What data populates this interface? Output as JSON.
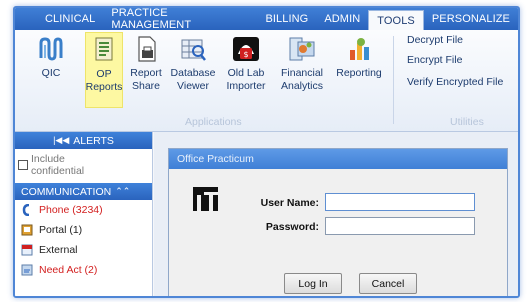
{
  "menu": {
    "tabs": [
      "CLINICAL",
      "PRACTICE MANAGEMENT",
      "BILLING",
      "ADMIN",
      "TOOLS",
      "PERSONALIZE"
    ],
    "active": "TOOLS"
  },
  "ribbon": {
    "buttons": {
      "qic": "QIC",
      "op_reports_1": "OP",
      "op_reports_2": "Reports",
      "report_share_1": "Report",
      "report_share_2": "Share",
      "database_viewer_1": "Database",
      "database_viewer_2": "Viewer",
      "old_lab_importer_1": "Old Lab",
      "old_lab_importer_2": "Importer",
      "financial_analytics_1": "Financial",
      "financial_analytics_2": "Analytics",
      "reporting": "Reporting"
    },
    "group_applications": "Applications",
    "utilities": {
      "decrypt": "Decrypt File",
      "encrypt": "Encrypt File",
      "verify": "Verify Encrypted File",
      "group_label": "Utilities"
    },
    "highlight_color": "#fdf8a2"
  },
  "left_pane": {
    "alerts_label": "ALERTS",
    "include_confidential_1": "Include",
    "include_confidential_2": "confidential",
    "communication_label": "COMMUNICATION",
    "items": [
      {
        "label": "Phone (3234)",
        "color": "#d31f1f"
      },
      {
        "label": "Portal (1)",
        "color": "#222222"
      },
      {
        "label": "External",
        "color": "#222222"
      },
      {
        "label": "Need Act (2)",
        "color": "#d31f1f"
      }
    ]
  },
  "login_dialog": {
    "title": "Office Practicum",
    "username_label": "User Name:",
    "username_value": "",
    "password_label": "Password:",
    "password_value": "",
    "login_button": "Log In",
    "cancel_button": "Cancel"
  }
}
